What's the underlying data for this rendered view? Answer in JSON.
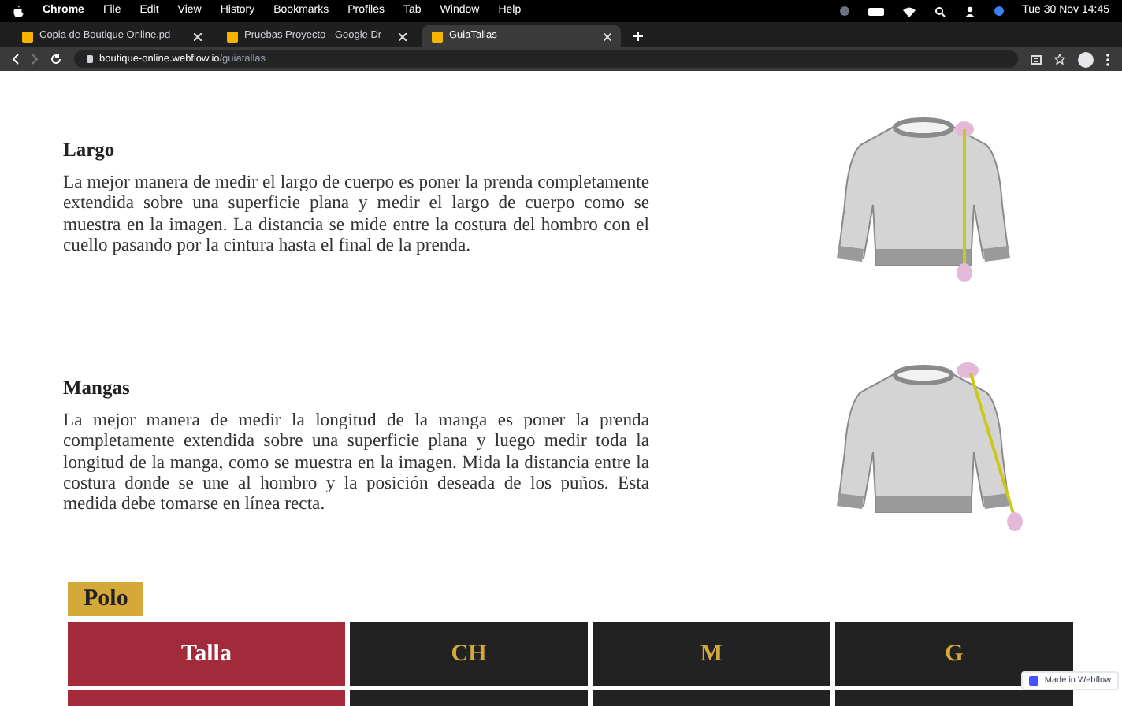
{
  "menu_bar": {
    "app": "Chrome",
    "items": [
      "File",
      "Edit",
      "View",
      "History",
      "Bookmarks",
      "Profiles",
      "Tab",
      "Window",
      "Help"
    ],
    "clock": "Tue 30 Nov 14:45"
  },
  "tabs": [
    {
      "title": "Copia de Boutique Online.pd",
      "selected": false
    },
    {
      "title": "Pruebas Proyecto - Google Dr",
      "selected": false
    },
    {
      "title": "GuiaTallas",
      "selected": true
    }
  ],
  "address_bar": {
    "host": "boutique-online.webflow.io",
    "path": "/guiatallas"
  },
  "sections": [
    {
      "title": "Largo",
      "text": "La mejor manera de medir el largo de cuerpo es poner la prenda completamente extendida sobre una superficie plana y medir el largo de cuerpo como se muestra en la imagen. La distancia se mide entre la costura del hombro con el cuello pasando por la cintura hasta el final de la prenda.",
      "kind": "length"
    },
    {
      "title": "Mangas",
      "text": "La mejor manera de medir la longitud de la manga es poner la prenda completamente extendida sobre una superficie plana y luego medir toda la longitud de la manga, como se muestra en la imagen. Mida la distancia entre la costura donde se une al hombro y la posición deseada de los puños. Esta medida debe tomarse en línea recta.",
      "kind": "sleeve"
    }
  ],
  "size_table": {
    "title": "Polo",
    "columns": [
      "Talla",
      "CH",
      "M",
      "G"
    ]
  },
  "badge": "Made in Webflow"
}
